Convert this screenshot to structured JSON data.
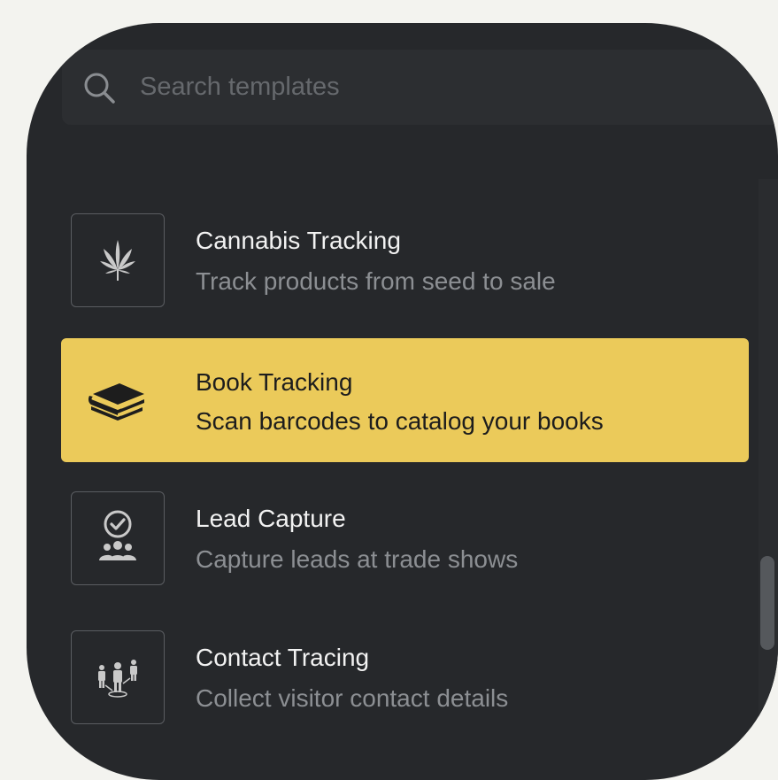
{
  "search": {
    "placeholder": "Search templates",
    "icon": "search-icon"
  },
  "templates": [
    {
      "title": "Cannabis Tracking",
      "description": "Track products from seed to sale",
      "icon": "cannabis-leaf-icon",
      "selected": false
    },
    {
      "title": "Book Tracking",
      "description": "Scan barcodes to catalog your books",
      "icon": "books-icon",
      "selected": true
    },
    {
      "title": "Lead Capture",
      "description": "Capture leads at trade shows",
      "icon": "lead-capture-icon",
      "selected": false
    },
    {
      "title": "Contact Tracing",
      "description": "Collect visitor contact details",
      "icon": "contact-tracing-icon",
      "selected": false
    }
  ],
  "colors": {
    "panel_background": "#26282b",
    "selected_background": "#ebca5a",
    "title_text": "#f2f2f2",
    "description_text": "#8c8f93"
  }
}
